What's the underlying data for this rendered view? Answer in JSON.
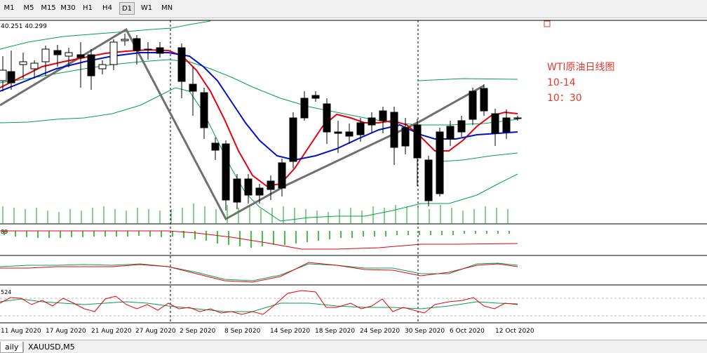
{
  "toolbar": {
    "timeframes": [
      "M1",
      "M5",
      "M15",
      "M30",
      "H1",
      "H4",
      "D1",
      "W1",
      "MN"
    ],
    "active": "D1"
  },
  "chart": {
    "price_readout": "40.251 40.299",
    "annotation": {
      "title": "WTI原油日线图",
      "date": "10-14",
      "time": "10：30",
      "color": "#e8372c"
    },
    "indicator_label_1": "89",
    "indicator_label_3": "524",
    "dates": [
      "11 Aug 2020",
      "17 Aug 2020",
      "21 Aug 2020",
      "27 Aug 2020",
      "2 Sep 2020",
      "8 Sep 2020",
      "14 Sep 2020",
      "18 Sep 2020",
      "24 Sep 2020",
      "30 Sep 2020",
      "6 Oct 2020",
      "12 Oct 2020"
    ],
    "colors": {
      "fast_ma": "#e8000b",
      "slow_ma": "#0010d0",
      "bands": "#00a050",
      "trendline": "#707070",
      "volume": "#00b000",
      "candle_bear": "#000000",
      "candle_bull": "#ffffff"
    }
  },
  "tabs": [
    "aily",
    "XAUUSD,M5"
  ]
}
